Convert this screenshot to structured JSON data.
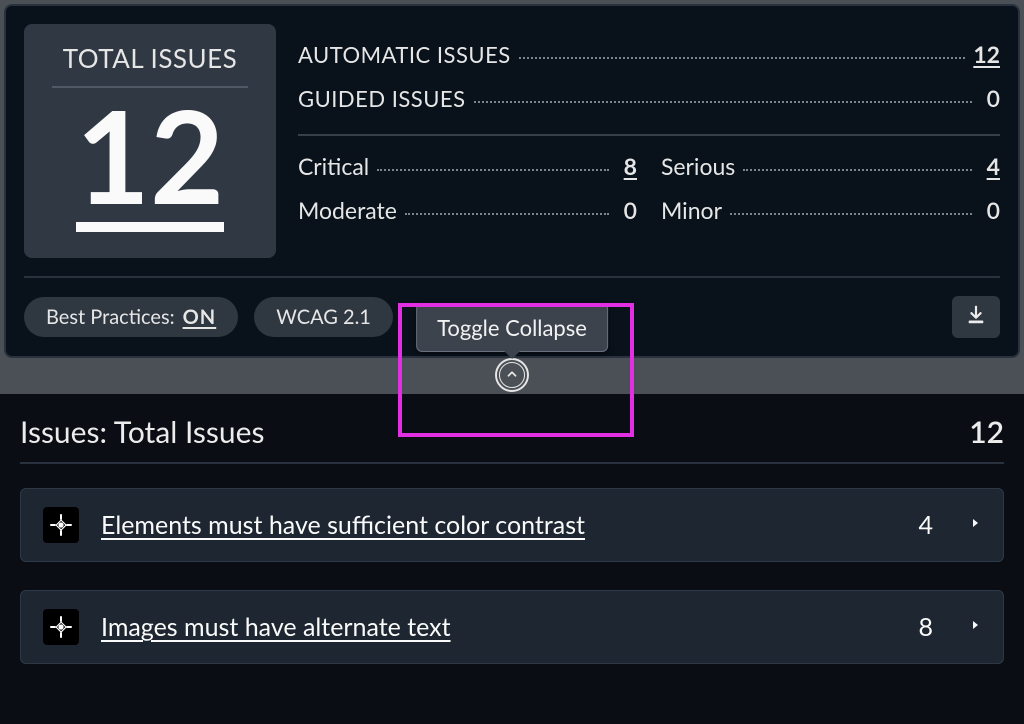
{
  "summary": {
    "total_label": "TOTAL ISSUES",
    "total_value": "12",
    "automatic_label": "AUTOMATIC ISSUES",
    "automatic_value": "12",
    "guided_label": "GUIDED ISSUES",
    "guided_value": "0",
    "severity": {
      "critical_label": "Critical",
      "critical_value": "8",
      "serious_label": "Serious",
      "serious_value": "4",
      "moderate_label": "Moderate",
      "moderate_value": "0",
      "minor_label": "Minor",
      "minor_value": "0"
    }
  },
  "toolbar": {
    "best_practices_label": "Best Practices: ",
    "best_practices_value": "ON",
    "wcag_label": "WCAG 2.1 "
  },
  "tooltip": {
    "toggle_collapse": "Toggle Collapse"
  },
  "issues_header": {
    "title": "Issues: Total Issues",
    "count": "12"
  },
  "issues": [
    {
      "desc": "Elements must have sufficient color contrast",
      "count": "4"
    },
    {
      "desc": "Images must have alternate text",
      "count": "8"
    }
  ]
}
